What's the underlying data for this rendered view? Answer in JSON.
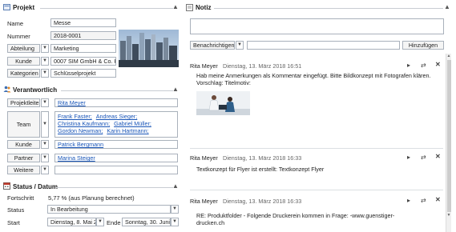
{
  "projekt": {
    "title": "Projekt",
    "name_label": "Name",
    "name_value": "Messe",
    "nummer_label": "Nummer",
    "nummer_value": "2018-0001",
    "abteilung_label": "Abteilung",
    "abteilung_value": "Marketing",
    "kunde_label": "Kunde",
    "kunde_value": "0007 SIM GmbH & Co. K",
    "kategorien_label": "Kategorien",
    "kategorien_value": "Schlüsselprojekt"
  },
  "verantwortlich": {
    "title": "Verantwortlich",
    "projektleiter_label": "Projektleiter",
    "projektleiter_value": "Rita Meyer",
    "team_label": "Team",
    "team_members": [
      "Frank Faster;",
      "Andreas Sieger;",
      "Christina Kaufmann;",
      "Gabriel Müller;",
      "Gordon Newman;",
      "Karin Hartmann;"
    ],
    "kunde_label": "Kunde",
    "kunde_value": "Patrick Bergmann",
    "partner_label": "Partner",
    "partner_value": "Marina Steiger",
    "weitere_label": "Weitere"
  },
  "status": {
    "title": "Status / Datum",
    "fortschritt_label": "Fortschritt",
    "fortschritt_value": "5,77 % (aus Planung berechnet)",
    "status_label": "Status",
    "status_value": "In Bearbeitung",
    "start_label": "Start",
    "start_value": "Dienstag, 8. Mai 2",
    "ende_label": "Ende",
    "ende_value": "Sonntag, 30. Juni"
  },
  "notiz": {
    "title": "Notiz",
    "notify_button": "Benachrichtigen",
    "add_button": "Hinzufügen",
    "notes": [
      {
        "author": "Rita Meyer",
        "date": "Dienstag, 13. März 2018 16:51",
        "text": "Hab meine Anmerkungen als Kommentar eingefügt. Bitte Bildkonzept mit Fotografen klären. Vorschlag: Titelmotiv:"
      },
      {
        "author": "Rita Meyer",
        "date": "Dienstag, 13. März 2018 16:33",
        "text": "Textkonzept für Flyer ist erstellt: Textkonzept Flyer"
      },
      {
        "author": "Rita Meyer",
        "date": "Dienstag, 13. März 2018 16:33",
        "text": "RE: Produktfolder - Folgende Druckerein kommen in Frage: -www.guenstiger-drucken.ch"
      }
    ]
  }
}
